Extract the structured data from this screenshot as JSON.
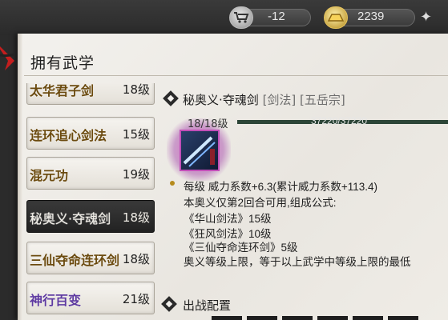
{
  "topbar": {
    "resource1": {
      "icon": "cart-icon",
      "value": "-12"
    },
    "resource2": {
      "icon": "gold-ingot-icon",
      "value": "2239"
    }
  },
  "panel": {
    "title": "拥有武学"
  },
  "skills": [
    {
      "name": "太华君子剑",
      "level": "18级",
      "selected": false,
      "color": "#6b4a0e"
    },
    {
      "name": "连环追心剑法",
      "level": "15级",
      "selected": false,
      "color": "#6b4a0e"
    },
    {
      "name": "混元功",
      "level": "19级",
      "selected": false,
      "color": "#6b4a0e"
    },
    {
      "name": "秘奥义·夺魂剑",
      "level": "18级",
      "selected": true,
      "color": "#f0ede6"
    },
    {
      "name": "三仙夺命连环剑",
      "level": "18级",
      "selected": false,
      "color": "#6b4a0e"
    },
    {
      "name": "神行百变",
      "level": "21级",
      "selected": false,
      "color": "#5e3aa0"
    }
  ],
  "detail": {
    "name": "秘奥义·夺魂剑",
    "category": "[剑法] [五岳宗]",
    "level_progress": "18/18级",
    "exp": "37220/37220",
    "exp_fraction": 1.0,
    "lines": [
      "每级   威力系数+6.3(累计威力系数+113.4)",
      "本奥义仅第2回合可用,组成公式:",
      "《华山剑法》15级",
      "《狂风剑法》10级",
      "《三仙夺命连环剑》5级",
      "奥义等级上限，等于以上武学中等级上限的最低"
    ]
  },
  "battle": {
    "label": "出战配置"
  },
  "colors": {
    "accent_bar": "#2c4537",
    "rank_gold": "#6b4a0e",
    "rank_purple": "#5e3aa0"
  }
}
